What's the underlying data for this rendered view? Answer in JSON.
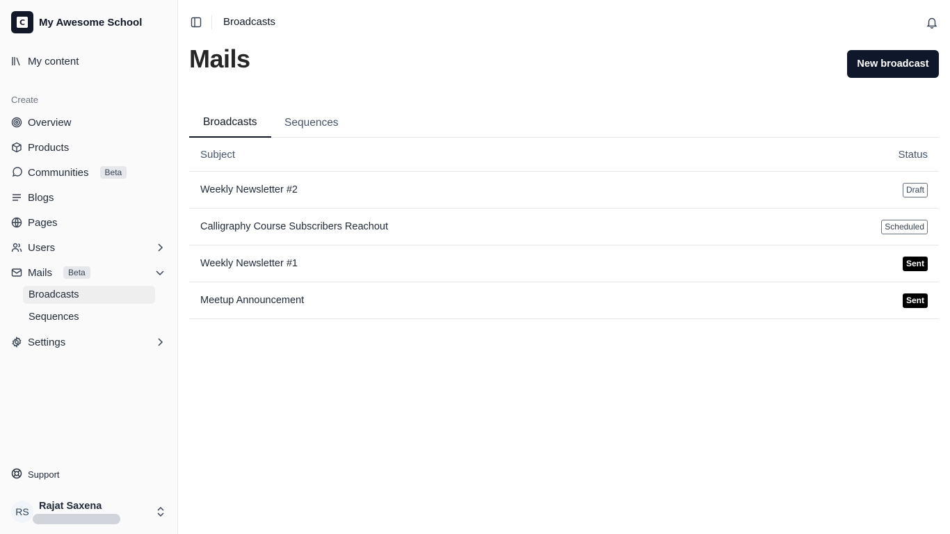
{
  "sidebar": {
    "school_name": "My Awesome School",
    "my_content": "My content",
    "group_label": "Create",
    "items": [
      {
        "label": "Overview"
      },
      {
        "label": "Products"
      },
      {
        "label": "Communities",
        "badge": "Beta"
      },
      {
        "label": "Blogs"
      },
      {
        "label": "Pages"
      },
      {
        "label": "Users"
      },
      {
        "label": "Mails",
        "badge": "Beta"
      },
      {
        "label": "Settings"
      }
    ],
    "mails_sub": [
      "Broadcasts",
      "Sequences"
    ],
    "support": "Support",
    "user": {
      "initials": "RS",
      "name": "Rajat Saxena"
    }
  },
  "topbar": {
    "breadcrumb": "Broadcasts"
  },
  "main": {
    "title": "Mails",
    "new_button": "New broadcast",
    "tabs": [
      "Broadcasts",
      "Sequences"
    ],
    "table": {
      "headers": [
        "Subject",
        "Status"
      ],
      "rows": [
        {
          "subject": "Weekly Newsletter #2",
          "status": "Draft"
        },
        {
          "subject": "Calligraphy Course Subscribers Reachout",
          "status": "Scheduled"
        },
        {
          "subject": "Weekly Newsletter #1",
          "status": "Sent"
        },
        {
          "subject": "Meetup Announcement",
          "status": "Sent"
        }
      ]
    }
  }
}
